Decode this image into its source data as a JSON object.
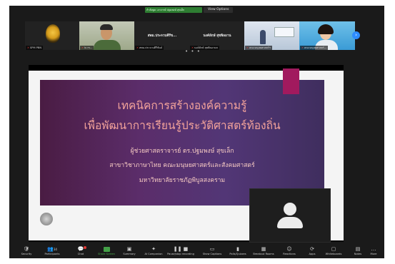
{
  "header": {
    "speaking_badge": "กำลังพูด: อาจารย์ ปฐมพงษ์ สุขเล็ก",
    "view_options_label": "View Options"
  },
  "participants": [
    {
      "name": "SPM PBN",
      "tile": "logo"
    },
    {
      "name": "lu m...",
      "tile": "video"
    },
    {
      "name": "สพม.ประจวบคีรีขันธ์",
      "center_label": "สพม.ประจวบคีรีข...",
      "tile": "name"
    },
    {
      "name": "นงค์ลักษ์ สุขพิลอานห",
      "center_label": "นงค์ลักษ์ สุขพิลอาน",
      "tile": "name"
    },
    {
      "name": "คณะมนุษยศาสตร์ฯ",
      "tile": "video"
    },
    {
      "name": "คณะมนุษยศาสตร์...",
      "tile": "video"
    }
  ],
  "slide": {
    "title_line1": "เทคนิคการสร้างองค์ความรู้",
    "title_line2": "เพื่อพัฒนาการเรียนรู้ประวัติศาสตร์ท้องถิ่น",
    "author": "ผู้ช่วยศาสตราจารย์ ดร.ปฐมพงษ์ สุขเล็ก",
    "department": "สาขาวิชาภาษาไทย คณะมนุษยศาสตร์และสังคมศาสตร์",
    "university": "มหาวิทยาลัยราชภัฏพิบูลสงคราม"
  },
  "toolbar": [
    {
      "icon": "shield-icon",
      "label": "Security"
    },
    {
      "icon": "participants-icon",
      "label": "Participants",
      "count": "34"
    },
    {
      "icon": "chat-icon",
      "label": "Chat"
    },
    {
      "icon": "share-screen-icon",
      "label": "Share Screen"
    },
    {
      "icon": "summary-icon",
      "label": "Summary"
    },
    {
      "icon": "ai-companion-icon",
      "label": "AI Companion"
    },
    {
      "icon": "record-icon",
      "label": "Pause/stop recording"
    },
    {
      "icon": "captions-icon",
      "label": "Show Captions"
    },
    {
      "icon": "polls-icon",
      "label": "Polls/Quizzes"
    },
    {
      "icon": "breakout-rooms-icon",
      "label": "Breakout Rooms"
    },
    {
      "icon": "reactions-icon",
      "label": "Reactions"
    },
    {
      "icon": "apps-icon",
      "label": "Apps"
    },
    {
      "icon": "whiteboards-icon",
      "label": "Whiteboards"
    },
    {
      "icon": "notes-icon",
      "label": "Notes"
    },
    {
      "icon": "more-icon",
      "label": "More"
    }
  ],
  "colors": {
    "share_green": "#43a047",
    "accent_blue": "#2d8cff",
    "slide_title": "#f2a29a",
    "slide_accent": "#a11a5e"
  }
}
